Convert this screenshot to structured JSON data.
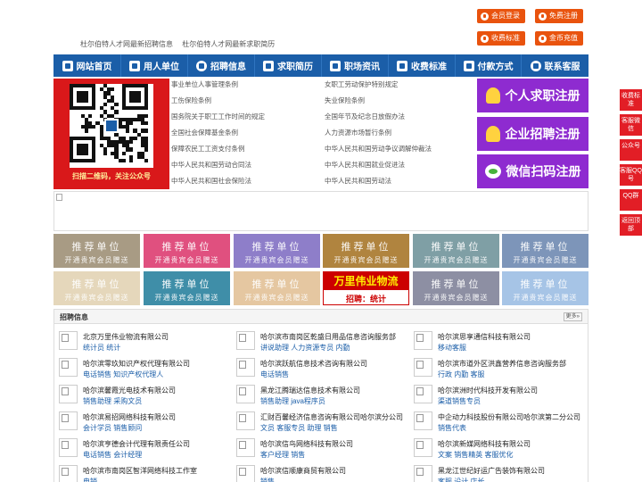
{
  "top": {
    "links": [
      "杜尔伯特人才网最新招聘信息",
      "杜尔伯特人才网最新求职简历"
    ],
    "buttons": [
      "会员登录",
      "免费注册",
      "收费标准",
      "金币充值"
    ]
  },
  "nav": {
    "items": [
      {
        "label": "网站首页",
        "icon": "home-icon"
      },
      {
        "label": "用人单位",
        "icon": "building-icon"
      },
      {
        "label": "招聘信息",
        "icon": "chat-icon"
      },
      {
        "label": "求职简历",
        "icon": "resume-icon"
      },
      {
        "label": "职场资讯",
        "icon": "news-icon"
      },
      {
        "label": "收费标准",
        "icon": "chart-icon"
      },
      {
        "label": "付款方式",
        "icon": "card-icon"
      },
      {
        "label": "联系客服",
        "icon": "phone-icon"
      }
    ]
  },
  "qr": {
    "caption": "扫描二维码，关注公众号"
  },
  "laws": [
    "事业单位人事管理条例",
    "女职工劳动保护特别规定",
    "工伤保险条例",
    "失业保险条例",
    "国务院关于职工工作时间的规定",
    "全国年节及纪念日放假办法",
    "全国社会保障基金条例",
    "人力资源市场暂行条例",
    "保障农民工工资支付条例",
    "中华人民共和国劳动争议调解仲裁法",
    "中华人民共和国劳动合同法",
    "中华人民共和国就业促进法",
    "中华人民共和国社会保险法",
    "中华人民共和国劳动法"
  ],
  "register": [
    "个人求职注册",
    "企业招聘注册",
    "微信扫码注册"
  ],
  "tiles": {
    "title": "推荐单位",
    "subtitle": "开通贵宾会员赠送",
    "ad_title": "万里伟业物流",
    "ad_sub": "招聘：统计"
  },
  "colors": {
    "nav": "#1b5ea8",
    "accent": "#e9530e",
    "register": "#8e2bd0",
    "tiles": [
      "#a89b84",
      "#e0507f",
      "#8e7ec9",
      "#b0843f",
      "#7f9fa5",
      "#7d95b9",
      "#e5d7bb",
      "#3f8ea8",
      "#e5c7a1",
      "#8d8fa3",
      "#a6c4e6"
    ]
  },
  "jobs": {
    "title": "招聘信息",
    "more": "更多»",
    "items": [
      {
        "company": "北京万里伟业物流有限公司",
        "positions": "统计员 统计"
      },
      {
        "company": "哈尔滨市南岗区乾盛日用品信息咨询服务部",
        "positions": "讲说助理 人力资源专员 内勤"
      },
      {
        "company": "哈尔滨思享通信科技有限公司",
        "positions": "移动客服"
      },
      {
        "company": "哈尔滨零玖知识产权代理有限公司",
        "positions": "电话销售 知识产权代理人"
      },
      {
        "company": "哈尔滨跃航信息技术咨询有限公司",
        "positions": "电话销售"
      },
      {
        "company": "哈尔滨市道外区洪鑫营养信息咨询服务部",
        "positions": "行政 内勤 客服"
      },
      {
        "company": "哈尔滨馨霞光电技术有限公司",
        "positions": "销售助理 采购文员"
      },
      {
        "company": "黑龙江腾瑞达信息技术有限公司",
        "positions": "销售助理 java程序员"
      },
      {
        "company": "哈尔滨洲时代科技开发有限公司",
        "positions": "渠道销售专员"
      },
      {
        "company": "哈尔滨易招网络科技有限公司",
        "positions": "会计学员 销售顾问"
      },
      {
        "company": "汇财百馨经济信息咨询有限公司哈尔滨分公司",
        "positions": "文员 客服专员 助理 销售"
      },
      {
        "company": "中企动力科技股份有限公司哈尔滨第二分公司",
        "positions": "销售代表"
      },
      {
        "company": "哈尔滨亨德会计代理有限责任公司",
        "positions": "电话销售 会计经理"
      },
      {
        "company": "哈尔滨信鸟网络科技有限公司",
        "positions": "客户经理 销售"
      },
      {
        "company": "哈尔滨新媒网络科技有限公司",
        "positions": "文案 销售精英 客服优化"
      },
      {
        "company": "哈尔滨市南岗区智洋网络科技工作室",
        "positions": "电销"
      },
      {
        "company": "哈尔滨信顺康商贸有限公司",
        "positions": "销售"
      },
      {
        "company": "黑龙江世纪好运广告装饰有限公司",
        "positions": "客服 设计 店长"
      }
    ]
  },
  "side": [
    "收费标准",
    "客服微信",
    "公众号",
    "客服QQ号",
    "QQ群",
    "返回顶部"
  ]
}
